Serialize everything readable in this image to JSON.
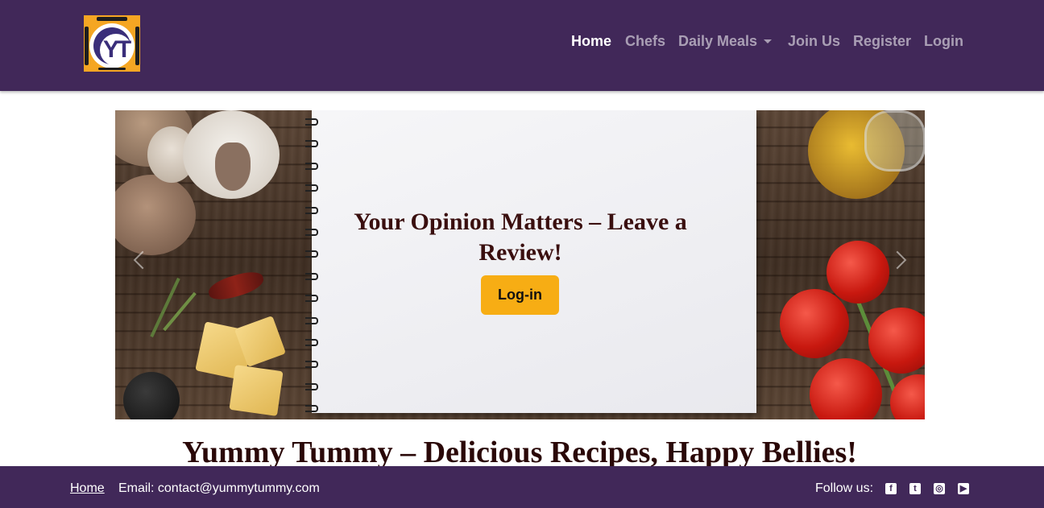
{
  "brand": {
    "logo_text": "YT",
    "icon": "yummy-tummy-logo"
  },
  "nav": {
    "items": [
      {
        "label": "Home",
        "active": true
      },
      {
        "label": "Chefs",
        "active": false
      },
      {
        "label": "Daily Meals",
        "active": false,
        "dropdown": true
      },
      {
        "label": "Join Us",
        "active": false
      },
      {
        "label": "Register",
        "active": false
      },
      {
        "label": "Login",
        "active": false
      }
    ]
  },
  "carousel": {
    "caption": "Your Opinion Matters – Leave a Review!",
    "button_label": "Log-in",
    "prev_icon": "chevron-left-icon",
    "next_icon": "chevron-right-icon"
  },
  "hero": {
    "title": "Yummy Tummy – Delicious Recipes, Happy Bellies!"
  },
  "footer": {
    "home_label": "Home",
    "email_text": "Email: contact@yummytummy.com",
    "follow_label": "Follow us:",
    "social_icons": [
      "facebook-icon",
      "twitter-icon",
      "instagram-icon",
      "youtube-icon"
    ]
  },
  "colors": {
    "nav_bg": "#412859",
    "accent": "#f7ad14",
    "heading": "#2a0808"
  }
}
